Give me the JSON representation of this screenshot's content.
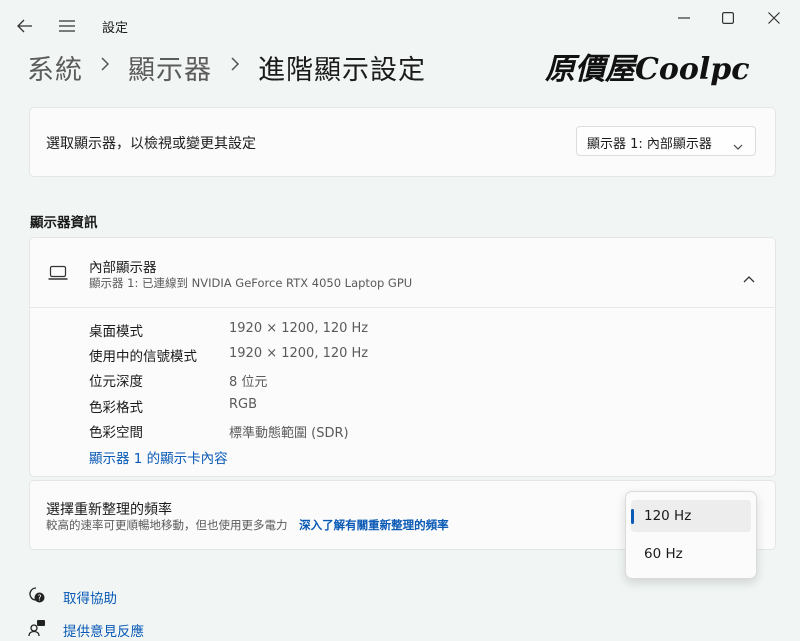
{
  "window": {
    "title": "設定",
    "icons": {
      "back": "back-arrow-icon",
      "menu": "hamburger-menu-icon",
      "minimize": "minimize-icon",
      "maximize": "maximize-icon",
      "close": "close-icon"
    }
  },
  "breadcrumb": {
    "items": [
      "系統",
      "顯示器",
      "進階顯示設定"
    ]
  },
  "logo": {
    "text": "原價屋Coolpc"
  },
  "display_select": {
    "label": "選取顯示器，以檢視或變更其設定",
    "selected": "顯示器 1: 內部顯示器"
  },
  "display_info": {
    "section_title": "顯示器資訊",
    "name": "內部顯示器",
    "subtitle": "顯示器 1: 已連線到 NVIDIA GeForce RTX 4050 Laptop GPU",
    "rows": [
      {
        "label": "桌面模式",
        "value": "1920 × 1200, 120 Hz"
      },
      {
        "label": "使用中的信號模式",
        "value": "1920 × 1200, 120 Hz"
      },
      {
        "label": "位元深度",
        "value": "8 位元"
      },
      {
        "label": "色彩格式",
        "value": "RGB"
      },
      {
        "label": "色彩空間",
        "value": "標準動態範圍 (SDR)"
      }
    ],
    "adapter_link": "顯示器 1 的顯示卡內容"
  },
  "refresh_rate": {
    "title": "選擇重新整理的頻率",
    "description": "較高的速率可更順暢地移動，但也使用更多電力",
    "learn_more": "深入了解有關重新整理的頻率",
    "options": [
      "120 Hz",
      "60 Hz"
    ],
    "selected": "120 Hz"
  },
  "footer": {
    "help": "取得協助",
    "feedback": "提供意見反應"
  },
  "colors": {
    "accent": "#0a5ab6",
    "background": "#f1f6f5",
    "card": "#fbfbfb"
  }
}
